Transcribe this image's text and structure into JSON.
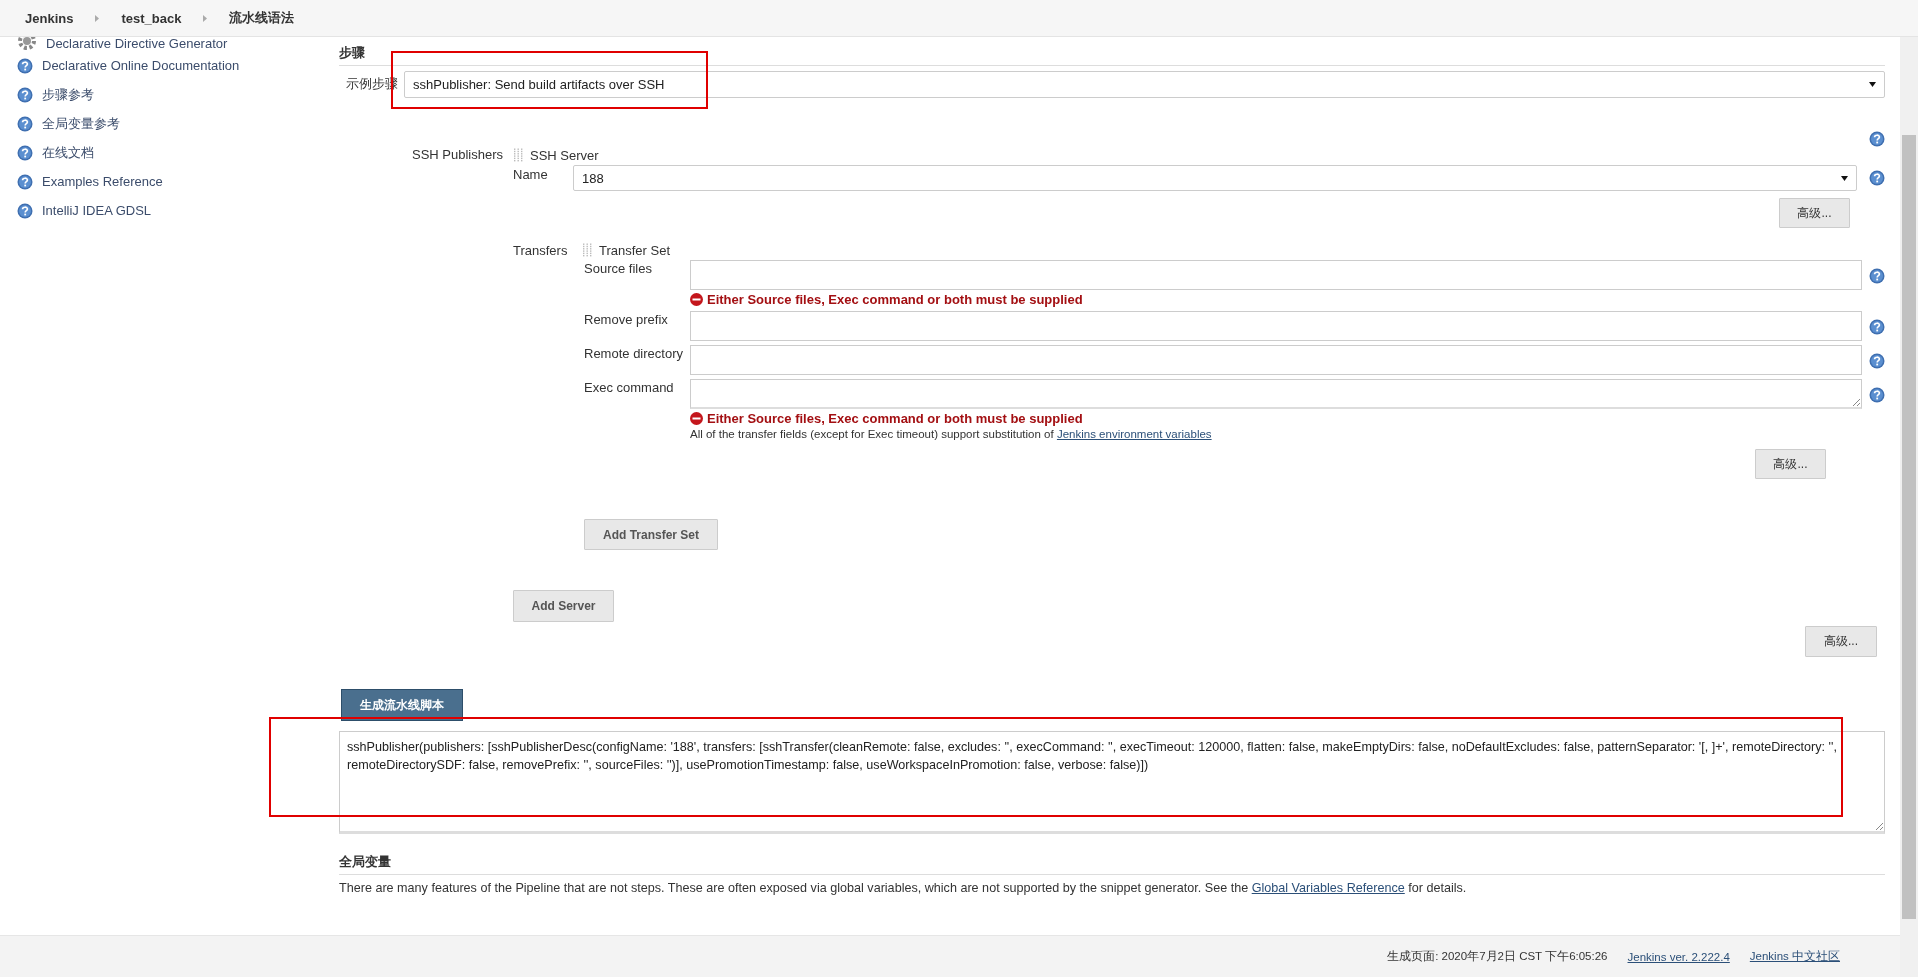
{
  "breadcrumbs": [
    {
      "label": "Jenkins"
    },
    {
      "label": "test_back"
    },
    {
      "label": "流水线语法"
    }
  ],
  "sidebar": {
    "items": [
      {
        "label": "Declarative Directive Generator",
        "kind": "gear"
      },
      {
        "label": "Declarative Online Documentation",
        "kind": "help"
      },
      {
        "label": "步骤参考",
        "kind": "help"
      },
      {
        "label": "全局变量参考",
        "kind": "help"
      },
      {
        "label": "在线文档",
        "kind": "help"
      },
      {
        "label": "Examples Reference",
        "kind": "help"
      },
      {
        "label": "IntelliJ IDEA GDSL",
        "kind": "help"
      }
    ]
  },
  "steps": {
    "title": "步骤",
    "label": "示例步骤",
    "value": "sshPublisher: Send build artifacts over SSH"
  },
  "ssh_publishers": {
    "label": "SSH Publishers",
    "server_title": "SSH Server",
    "name_label": "Name",
    "name_value": "188",
    "advanced_button": "高级...",
    "transfers_label": "Transfers",
    "transfer_set_title": "Transfer Set",
    "fields": [
      {
        "label": "Source files",
        "kind": "input",
        "error": "Either Source files, Exec command or both must be supplied"
      },
      {
        "label": "Remove prefix",
        "kind": "input"
      },
      {
        "label": "Remote directory",
        "kind": "input"
      },
      {
        "label": "Exec command",
        "kind": "textarea",
        "error": "Either Source files, Exec command or both must be supplied"
      }
    ],
    "note": {
      "text": "All of the transfer fields (except for Exec timeout) support substitution of ",
      "link": "Jenkins environment variables"
    },
    "transfer_advanced_button": "高级...",
    "add_transfer_button": "Add Transfer Set",
    "add_server_button": "Add Server"
  },
  "advanced_button": "高级...",
  "generate_button": "生成流水线脚本",
  "script": "sshPublisher(publishers: [sshPublisherDesc(configName: '188', transfers: [sshTransfer(cleanRemote: false, excludes: '', execCommand: '', execTimeout: 120000, flatten: false, makeEmptyDirs: false, noDefaultExcludes: false, patternSeparator: '[, ]+', remoteDirectory: '', remoteDirectorySDF: false, removePrefix: '', sourceFiles: '')], usePromotionTimestamp: false, useWorkspaceInPromotion: false, verbose: false)])",
  "global_variables": {
    "title": "全局变量",
    "text": "There are many features of the Pipeline that are not steps. These are often exposed via global variables, which are not supported by the snippet generator. See the ",
    "link": "Global Variables Reference",
    "after": " for details."
  },
  "footer": {
    "generated": "生成页面: 2020年7月2日 CST 下午6:05:26",
    "version_link": "Jenkins ver. 2.222.4",
    "community_link": "Jenkins 中文社区"
  },
  "annotations": [
    {
      "kind": "frame"
    },
    {
      "kind": "frame"
    }
  ]
}
